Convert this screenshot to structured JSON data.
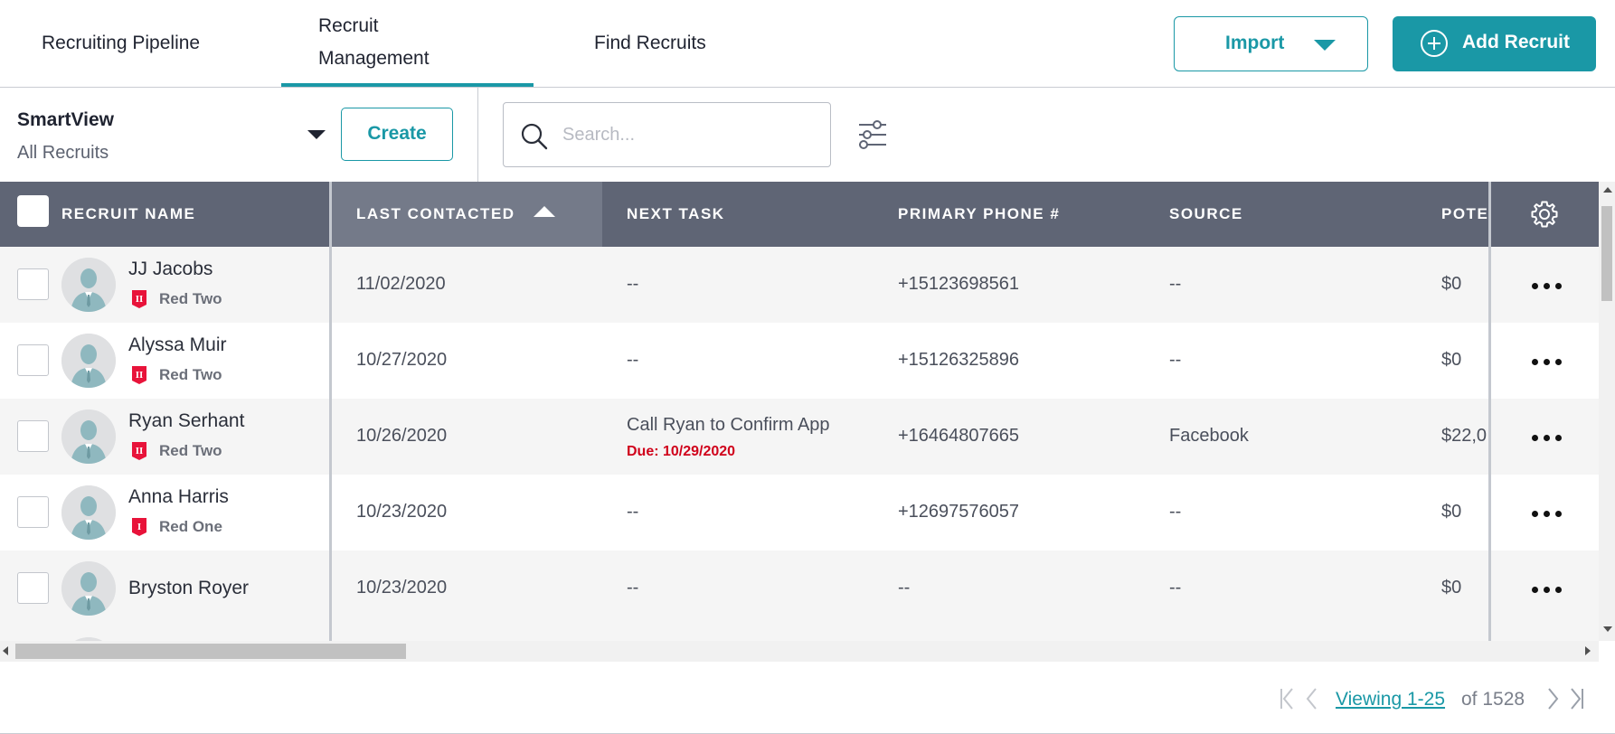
{
  "nav": {
    "tabs": [
      {
        "label": "Recruiting Pipeline",
        "active": false
      },
      {
        "label": "Recruit Management",
        "active": true
      },
      {
        "label": "Find Recruits",
        "active": false
      }
    ],
    "import_label": "Import",
    "add_label": "Add Recruit"
  },
  "toolbar": {
    "smartview_title": "SmartView",
    "smartview_value": "All Recruits",
    "create_label": "Create",
    "search_placeholder": "Search..."
  },
  "table": {
    "columns": [
      "RECRUIT NAME",
      "LAST CONTACTED",
      "NEXT TASK",
      "PRIMARY PHONE #",
      "SOURCE",
      "POTE"
    ],
    "sorted_column": "LAST CONTACTED",
    "rows": [
      {
        "name": "JJ Jacobs",
        "team": "Red Two",
        "badge": "II",
        "last_contacted": "11/02/2020",
        "next_task": "--",
        "task_due": "",
        "phone": "+15123698561",
        "source": "--",
        "potential": "$0"
      },
      {
        "name": "Alyssa Muir",
        "team": "Red Two",
        "badge": "II",
        "last_contacted": "10/27/2020",
        "next_task": "--",
        "task_due": "",
        "phone": "+15126325896",
        "source": "--",
        "potential": "$0"
      },
      {
        "name": "Ryan Serhant",
        "team": "Red Two",
        "badge": "II",
        "last_contacted": "10/26/2020",
        "next_task": "Call Ryan to Confirm App",
        "task_due": "Due: 10/29/2020",
        "phone": "+16464807665",
        "source": "Facebook",
        "potential": "$22,0"
      },
      {
        "name": "Anna Harris",
        "team": "Red One",
        "badge": "I",
        "last_contacted": "10/23/2020",
        "next_task": "--",
        "task_due": "",
        "phone": "+12697576057",
        "source": "--",
        "potential": "$0"
      },
      {
        "name": "Bryston Royer",
        "team": "",
        "badge": "",
        "last_contacted": "10/23/2020",
        "next_task": "--",
        "task_due": "",
        "phone": "--",
        "source": "--",
        "potential": "$0"
      }
    ]
  },
  "pagination": {
    "range_label": "Viewing 1-25",
    "total_label": "of 1528"
  },
  "colors": {
    "accent": "#1a98a6",
    "header_bg": "#5f6575",
    "due_red": "#d0021b",
    "badge_red": "#e8133a"
  }
}
